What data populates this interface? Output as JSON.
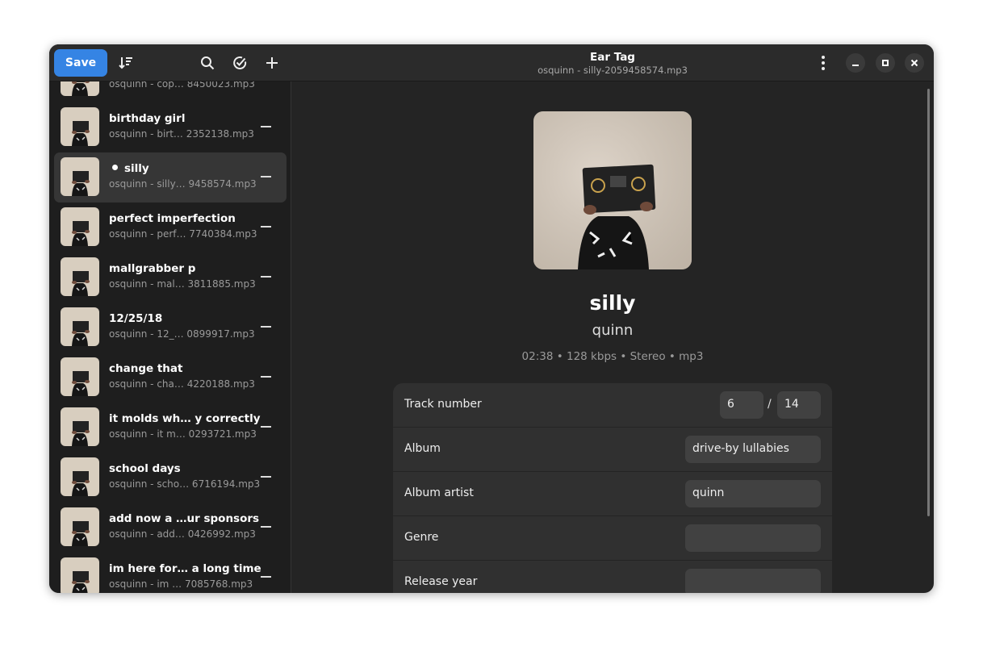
{
  "sidebar": {
    "save_label": "Save",
    "items": [
      {
        "title": "",
        "subtitle": "osquinn - cop… 8450023.mp3",
        "selected": false,
        "modified": false
      },
      {
        "title": "birthday girl",
        "subtitle": "osquinn - birt…  2352138.mp3",
        "selected": false,
        "modified": false
      },
      {
        "title": "silly",
        "subtitle": "osquinn - silly… 9458574.mp3",
        "selected": true,
        "modified": true
      },
      {
        "title": "perfect imperfection",
        "subtitle": "osquinn - perf… 7740384.mp3",
        "selected": false,
        "modified": false
      },
      {
        "title": "mallgrabber p",
        "subtitle": "osquinn - mal…  3811885.mp3",
        "selected": false,
        "modified": false
      },
      {
        "title": "12/25/18",
        "subtitle": "osquinn - 12_…  0899917.mp3",
        "selected": false,
        "modified": false
      },
      {
        "title": "change that",
        "subtitle": "osquinn - cha…  4220188.mp3",
        "selected": false,
        "modified": false
      },
      {
        "title": "it molds wh… y correctly",
        "subtitle": "osquinn - it m…  0293721.mp3",
        "selected": false,
        "modified": false
      },
      {
        "title": "school days",
        "subtitle": "osquinn - scho… 6716194.mp3",
        "selected": false,
        "modified": false
      },
      {
        "title": "add now a …ur sponsors",
        "subtitle": "osquinn - add… 0426992.mp3",
        "selected": false,
        "modified": false
      },
      {
        "title": "im here for… a long time",
        "subtitle": "osquinn - im …  7085768.mp3",
        "selected": false,
        "modified": false
      }
    ]
  },
  "header": {
    "title": "Ear Tag",
    "subtitle": "osquinn - silly-2059458574.mp3"
  },
  "track": {
    "title": "silly",
    "artist": "quinn",
    "meta": "02:38 • 128 kbps • Stereo • mp3"
  },
  "fields": {
    "track_number": {
      "label": "Track number",
      "value": "6",
      "separator": "/",
      "total": "14"
    },
    "album": {
      "label": "Album",
      "value": "drive-by lullabies"
    },
    "album_artist": {
      "label": "Album artist",
      "value": "quinn"
    },
    "genre": {
      "label": "Genre",
      "value": ""
    },
    "release_year": {
      "label": "Release year",
      "value": ""
    }
  },
  "colors": {
    "accent": "#3584e4"
  }
}
